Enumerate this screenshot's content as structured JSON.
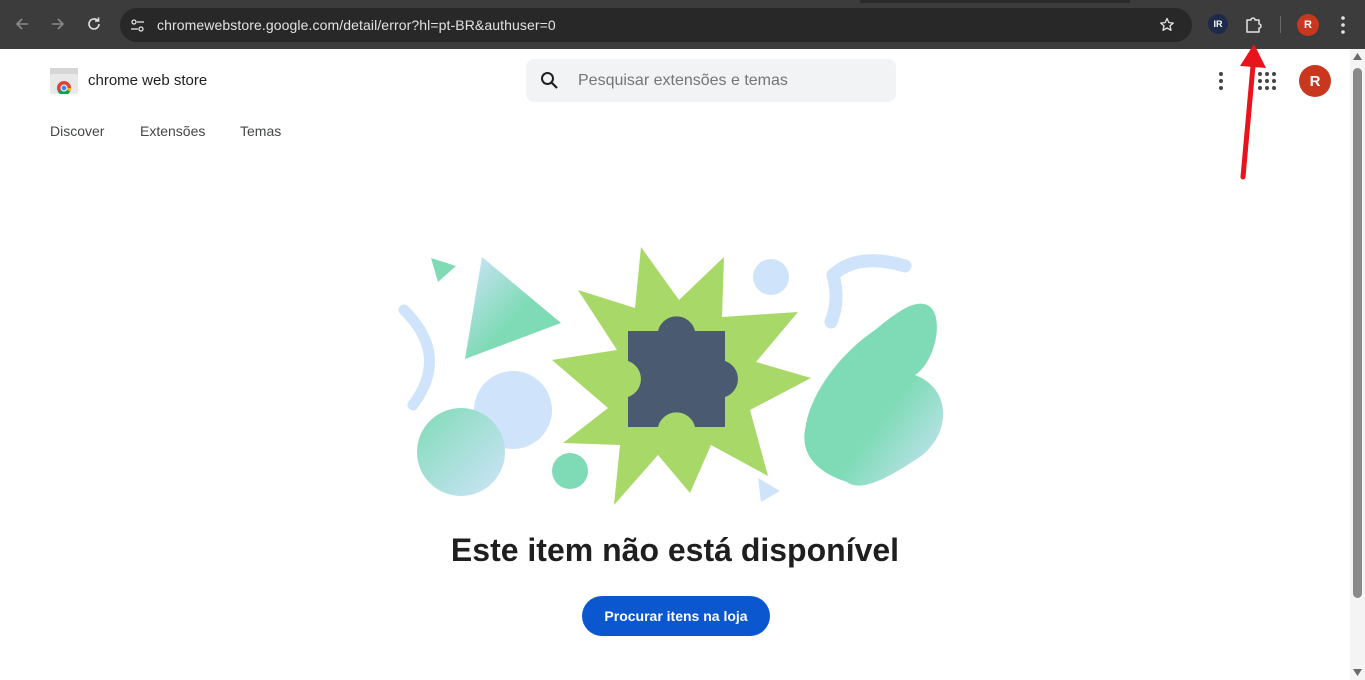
{
  "browser": {
    "url": "chromewebstore.google.com/detail/error?hl=pt-BR&authuser=0",
    "extension_badge": "IR",
    "profile_initial": "R",
    "icons": [
      "back-icon",
      "forward-icon",
      "reload-icon",
      "site-info-icon",
      "bookmark-star-icon",
      "extensions-puzzle-icon",
      "kebab-menu-icon"
    ]
  },
  "store": {
    "name": "chrome web store",
    "search_placeholder": "Pesquisar extensões e temas",
    "avatar_initial": "R",
    "nav": [
      {
        "label": "Discover"
      },
      {
        "label": "Extensões"
      },
      {
        "label": "Temas"
      }
    ]
  },
  "error": {
    "title": "Este item não está disponível",
    "button_label": "Procurar itens na loja"
  },
  "colors": {
    "toolbar_bg": "#3c3c3c",
    "primary_button": "#0b57d0",
    "avatar": "#c9371e",
    "star_green": "#a8d868",
    "puzzle": "#4a5a70",
    "annotation_arrow": "#e8131b"
  }
}
